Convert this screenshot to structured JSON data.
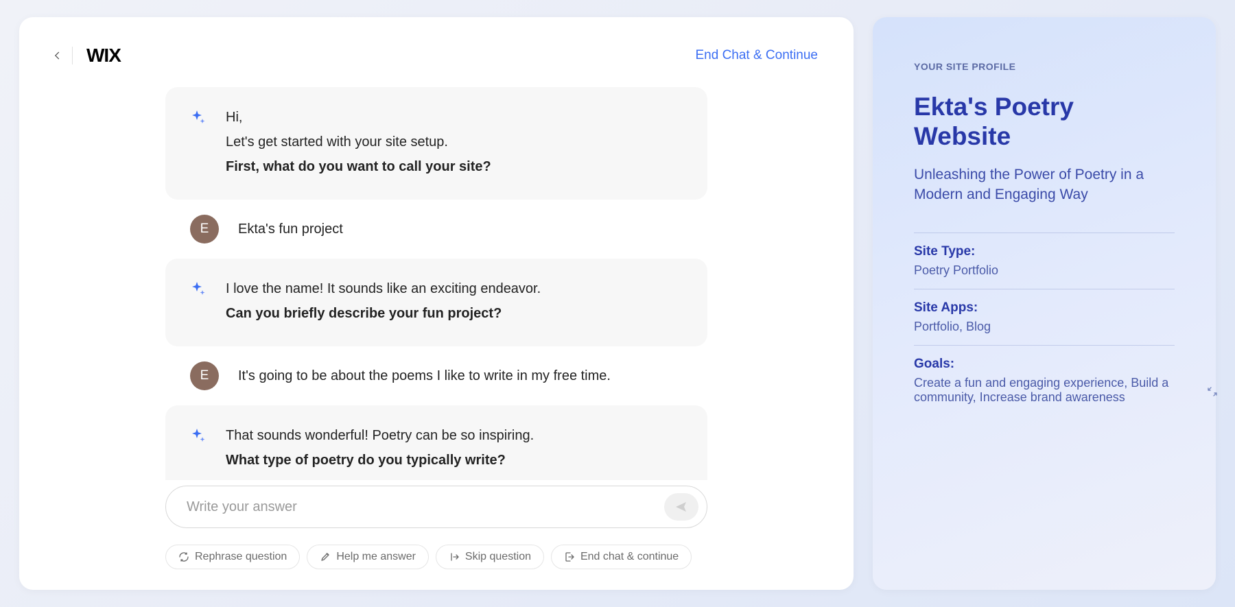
{
  "header": {
    "logo": "WIX",
    "end_chat_link": "End Chat & Continue"
  },
  "chat": {
    "messages": [
      {
        "type": "bot",
        "lines": [
          {
            "text": "Hi,",
            "strong": false
          },
          {
            "text": "Let's get started with your site setup.",
            "strong": false
          },
          {
            "text": "First, what do you want to call your site?",
            "strong": true
          }
        ]
      },
      {
        "type": "user",
        "initial": "E",
        "text": "Ekta's fun project"
      },
      {
        "type": "bot",
        "lines": [
          {
            "text": "I love the name! It sounds like an exciting endeavor.",
            "strong": false
          },
          {
            "text": "Can you briefly describe your fun project?",
            "strong": true
          }
        ]
      },
      {
        "type": "user",
        "initial": "E",
        "text": "It's going to be about the poems I like to write in my free time."
      },
      {
        "type": "bot",
        "lines": [
          {
            "text": "That sounds wonderful! Poetry can be so inspiring.",
            "strong": false
          },
          {
            "text": "What type of poetry do you typically write?",
            "strong": true
          }
        ]
      }
    ],
    "input_placeholder": "Write your answer",
    "actions": {
      "rephrase": "Rephrase question",
      "help": "Help me answer",
      "skip": "Skip question",
      "end": "End chat & continue"
    }
  },
  "profile": {
    "label": "YOUR SITE PROFILE",
    "title": "Ekta's Poetry Website",
    "subtitle": "Unleashing the Power of Poetry in a Modern and Engaging Way",
    "fields": [
      {
        "label": "Site Type:",
        "value": "Poetry Portfolio"
      },
      {
        "label": "Site Apps:",
        "value": "Portfolio, Blog"
      },
      {
        "label": "Goals:",
        "value": "Create a fun and engaging experience, Build a community, Increase brand awareness"
      }
    ]
  }
}
